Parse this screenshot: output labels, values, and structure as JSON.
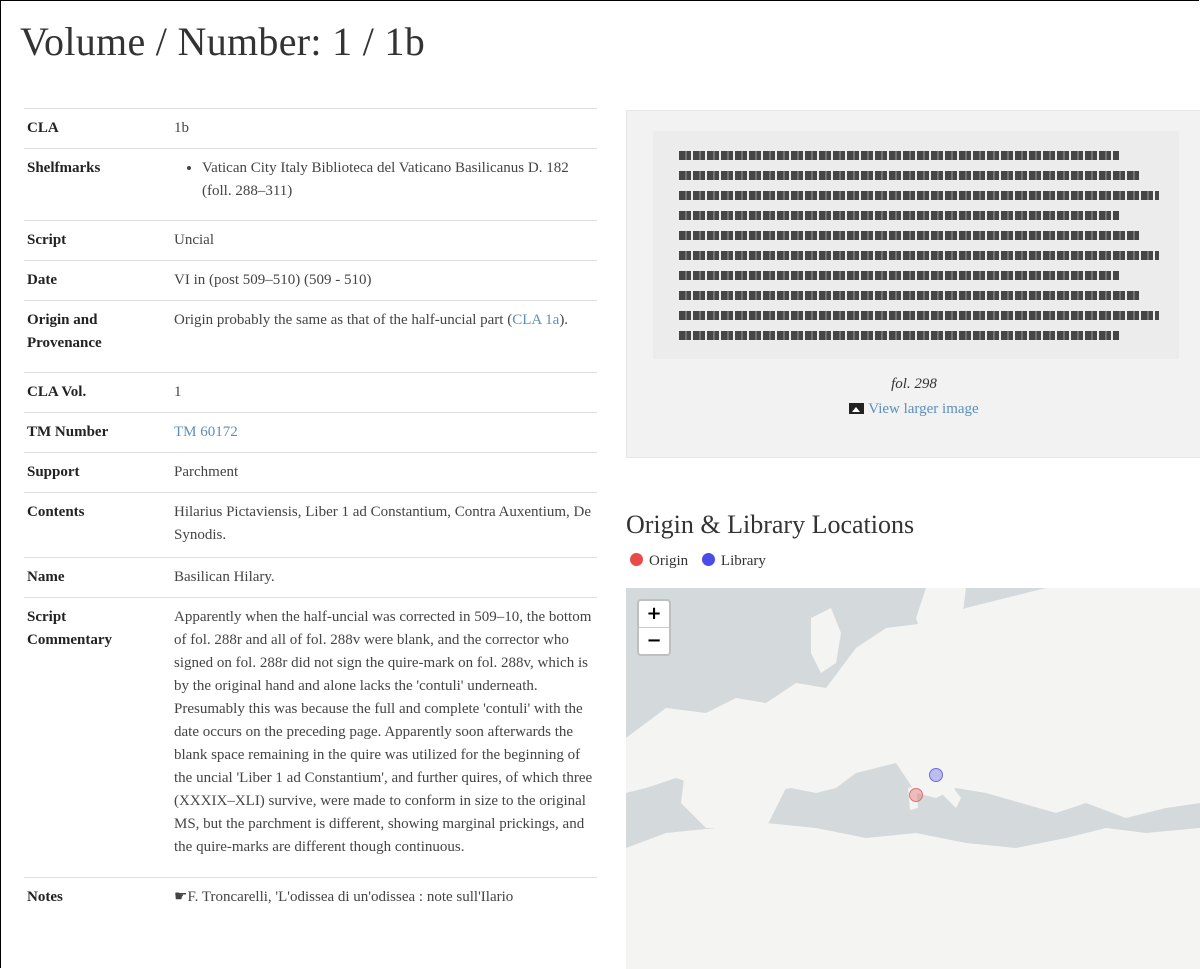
{
  "page": {
    "title": "Volume / Number: 1 / 1b"
  },
  "meta": {
    "cla_label": "CLA",
    "cla_value": "1b",
    "shelfmarks_label": "Shelfmarks",
    "shelfmarks": [
      "Vatican City Italy Biblioteca del Vaticano Basilicanus D. 182 (foll. 288–311)"
    ],
    "script_label": "Script",
    "script_value": "Uncial",
    "date_label": "Date",
    "date_value": "VI in (post 509–510) (509 - 510)",
    "origin_label_1": "Origin and",
    "origin_label_2": "Provenance",
    "origin_text": "Origin probably the same as that of the half-uncial part (",
    "origin_link": "CLA 1a",
    "origin_tail": ").",
    "clavol_label": "CLA Vol.",
    "clavol_value": "1",
    "tm_label": "TM Number",
    "tm_value": "TM 60172",
    "support_label": "Support",
    "support_value": "Parchment",
    "contents_label": "Contents",
    "contents_value": "Hilarius Pictaviensis, Liber 1 ad Constantium, Contra Auxentium, De Synodis.",
    "name_label": "Name",
    "name_value": "Basilican Hilary.",
    "commentary_label_1": "Script",
    "commentary_label_2": "Commentary",
    "commentary_value": "Apparently when the half-uncial was corrected in 509–10, the bottom of fol. 288r and all of fol. 288v were blank, and the corrector who signed on fol. 288r did not sign the quire-mark on fol. 288v, which is by the original hand and alone lacks the 'contuli' underneath. Presumably this was because the full and complete 'contuli' with the date occurs on the preceding page. Apparently soon afterwards the blank space remaining in the quire was utilized for the beginning of the uncial 'Liber 1 ad Constantium', and further quires, of which three (XXXIX–XLI) survive, were made to conform in size to the original MS, but the parchment is different, showing marginal prickings, and the quire-marks are different though continuous.",
    "notes_label": "Notes",
    "notes_value": "☛F. Troncarelli, 'L'odissea di un'odissea : note sull'Ilario"
  },
  "image": {
    "caption": "fol. 298",
    "view_larger": "View larger image"
  },
  "map": {
    "title": "Origin & Library Locations",
    "legend_origin": "Origin",
    "legend_library": "Library",
    "zoom_in": "+",
    "zoom_out": "−",
    "origin_color": "#e05555",
    "library_color": "#5555e0"
  }
}
